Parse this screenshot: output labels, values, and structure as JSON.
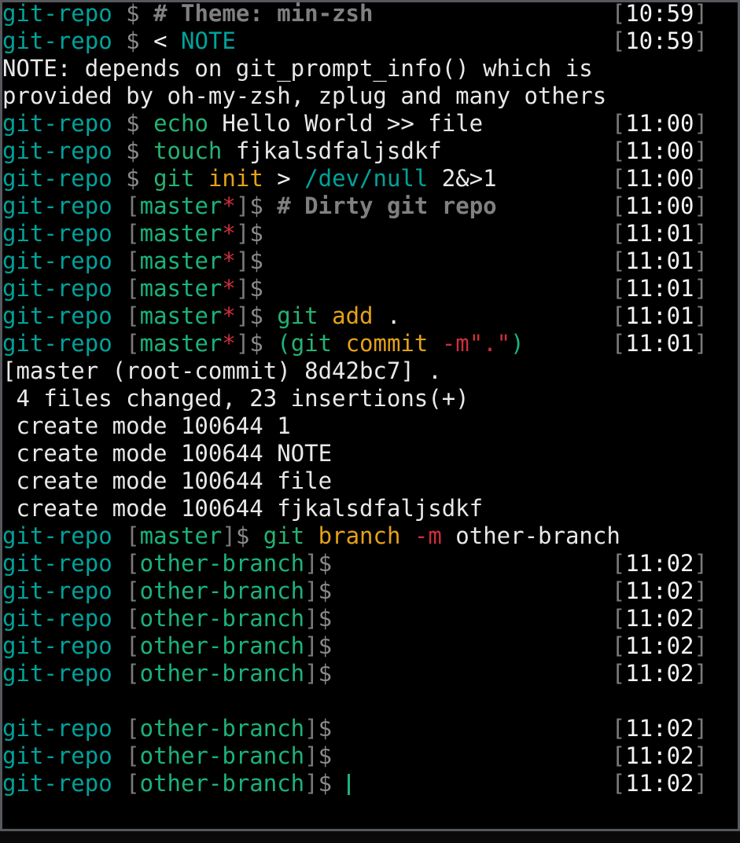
{
  "terminal": {
    "title": "git-repo terminal session",
    "theme_name": "min-zsh",
    "host": "git-repo",
    "prompt_symbol": "$",
    "cursor": "|",
    "colors": {
      "background": "#000000",
      "host": "#00a39a",
      "branch": "#1bb37b",
      "bracket": "#7a7a7a",
      "dirty_marker": "#cc2f3a",
      "dollar": "#8a8a8a",
      "comment": "#808080",
      "command": "#25b372",
      "subcommand": "#e5a119",
      "flag": "#cc2f3a",
      "path": "#00a39a",
      "plain_text": "#e8e8e8",
      "timestamp": "#f4f4f4",
      "window_border": "#55585c"
    }
  },
  "lines": [
    {
      "id": "l1",
      "host": "git-repo",
      "lb": "",
      "branch": "",
      "dirty": "",
      "rb": "",
      "dollar": "$",
      "comment": "# Theme: min-zsh",
      "timestamp": "10:59"
    },
    {
      "id": "l2",
      "host": "git-repo",
      "dollar": "$",
      "redir": "<",
      "path": "NOTE",
      "timestamp": "10:59"
    },
    {
      "id": "l3",
      "output": "NOTE: depends on git_prompt_info() which is"
    },
    {
      "id": "l4",
      "output": "provided by oh-my-zsh, zplug and many others"
    },
    {
      "id": "l5",
      "host": "git-repo",
      "dollar": "$",
      "cmd": "echo",
      "plain": " Hello World >> file",
      "timestamp": "11:00"
    },
    {
      "id": "l6",
      "host": "git-repo",
      "dollar": "$",
      "cmd": "touch",
      "plain": " fjkalsdfaljsdkf",
      "timestamp": "11:00"
    },
    {
      "id": "l7",
      "host": "git-repo",
      "dollar": "$",
      "cmd": "git",
      "arg": "init",
      "redir": ">",
      "path": "/dev/null",
      "plain": " 2&>1",
      "timestamp": "11:00"
    },
    {
      "id": "l8",
      "host": "git-repo",
      "lb": "[",
      "branch": "master",
      "dirty": "*",
      "rb": "]",
      "dollar": "$",
      "comment": "# Dirty git repo",
      "timestamp": "11:00"
    },
    {
      "id": "l9",
      "host": "git-repo",
      "lb": "[",
      "branch": "master",
      "dirty": "*",
      "rb": "]",
      "dollar": "$",
      "timestamp": "11:01"
    },
    {
      "id": "l10",
      "host": "git-repo",
      "lb": "[",
      "branch": "master",
      "dirty": "*",
      "rb": "]",
      "dollar": "$",
      "timestamp": "11:01"
    },
    {
      "id": "l11",
      "host": "git-repo",
      "lb": "[",
      "branch": "master",
      "dirty": "*",
      "rb": "]",
      "dollar": "$",
      "timestamp": "11:01"
    },
    {
      "id": "l12",
      "host": "git-repo",
      "lb": "[",
      "branch": "master",
      "dirty": "*",
      "rb": "]",
      "dollar": "$",
      "cmd": "git",
      "arg": "add",
      "plain": " .",
      "timestamp": "11:01"
    },
    {
      "id": "l13",
      "host": "git-repo",
      "lb": "[",
      "branch": "master",
      "dirty": "*",
      "rb": "]",
      "dollar": "$",
      "open_paren": "(",
      "cmd": "git",
      "arg": "commit",
      "flag": "-m\".\"",
      "close_paren": ")",
      "timestamp": "11:01"
    },
    {
      "id": "l14",
      "output": "[master (root-commit) 8d42bc7] ."
    },
    {
      "id": "l15",
      "output": " 4 files changed, 23 insertions(+)"
    },
    {
      "id": "l16",
      "output": " create mode 100644 1"
    },
    {
      "id": "l17",
      "output": " create mode 100644 NOTE"
    },
    {
      "id": "l18",
      "output": " create mode 100644 file"
    },
    {
      "id": "l19",
      "output": " create mode 100644 fjkalsdfaljsdkf"
    },
    {
      "id": "l20",
      "host": "git-repo",
      "lb": "[",
      "branch": "master",
      "dirty": "",
      "rb": "]",
      "dollar": "$",
      "cmd": "git",
      "arg": "branch",
      "flag": "-m",
      "plain": " other-branch",
      "timestamp": ""
    },
    {
      "id": "l21",
      "host": "git-repo",
      "lb": "[",
      "branch": "other-branch",
      "dirty": "",
      "rb": "]",
      "dollar": "$",
      "timestamp": "11:02"
    },
    {
      "id": "l22",
      "host": "git-repo",
      "lb": "[",
      "branch": "other-branch",
      "dirty": "",
      "rb": "]",
      "dollar": "$",
      "timestamp": "11:02"
    },
    {
      "id": "l23",
      "host": "git-repo",
      "lb": "[",
      "branch": "other-branch",
      "dirty": "",
      "rb": "]",
      "dollar": "$",
      "timestamp": "11:02"
    },
    {
      "id": "l24",
      "host": "git-repo",
      "lb": "[",
      "branch": "other-branch",
      "dirty": "",
      "rb": "]",
      "dollar": "$",
      "timestamp": "11:02"
    },
    {
      "id": "l25",
      "host": "git-repo",
      "lb": "[",
      "branch": "other-branch",
      "dirty": "",
      "rb": "]",
      "dollar": "$",
      "timestamp": "11:02"
    },
    {
      "id": "l26",
      "blank": true
    },
    {
      "id": "l27",
      "host": "git-repo",
      "lb": "[",
      "branch": "other-branch",
      "dirty": "",
      "rb": "]",
      "dollar": "$",
      "timestamp": "11:02"
    },
    {
      "id": "l28",
      "host": "git-repo",
      "lb": "[",
      "branch": "other-branch",
      "dirty": "",
      "rb": "]",
      "dollar": "$",
      "timestamp": "11:02"
    },
    {
      "id": "l29",
      "host": "git-repo",
      "lb": "[",
      "branch": "other-branch",
      "dirty": "",
      "rb": "]",
      "dollar": "$",
      "has_cursor": true,
      "timestamp": "11:02"
    }
  ]
}
